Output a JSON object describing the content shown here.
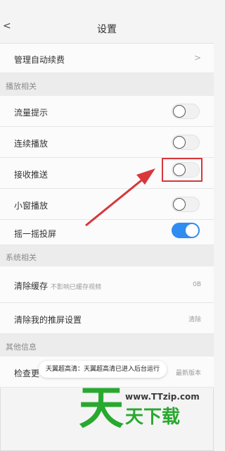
{
  "header": {
    "back_icon": "chevron-left-icon",
    "back_glyph": "<",
    "title": "设置"
  },
  "rows": {
    "auto_renew": {
      "label": "管理自动续费",
      "chevron": ">"
    },
    "traffic_tip": {
      "label": "流量提示",
      "on": false
    },
    "continuous_play": {
      "label": "连续播放",
      "on": false
    },
    "receive_push": {
      "label": "接收推送",
      "on": false
    },
    "mini_window": {
      "label": "小窗播放",
      "on": false
    },
    "shake_cast": {
      "label": "摇一摇投屏",
      "on": true
    },
    "clear_cache": {
      "label": "清除缓存",
      "sub": "不影响已缓存视频",
      "value": "0B"
    },
    "clear_cast": {
      "label": "清除我的推屏设置",
      "value": "清除"
    },
    "check_update": {
      "label": "检查更",
      "value": "最新版本"
    }
  },
  "sections": {
    "playback": "播放相关",
    "system": "系统相关",
    "other": "其他信息"
  },
  "toast": {
    "text": "天翼超高清：天翼超高清已进入后台运行"
  },
  "watermark": {
    "logo": "天",
    "url": "www.TTzip.com",
    "text": "天下载"
  },
  "colors": {
    "toggle_on": "#2f8cf0",
    "highlight": "#d8373b",
    "watermark_green": "#29a82f"
  }
}
